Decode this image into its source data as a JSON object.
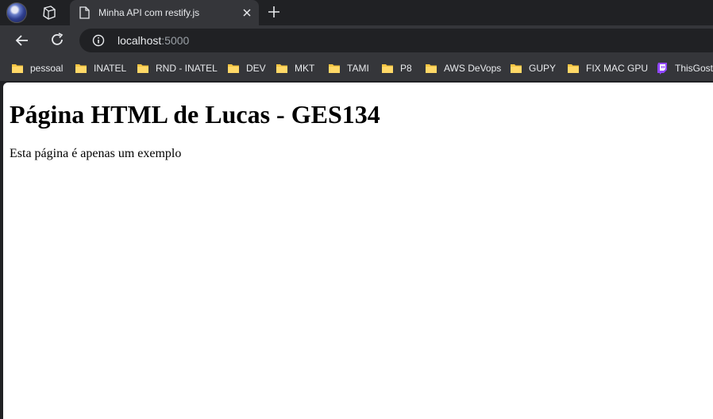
{
  "browser": {
    "tab_title": "Minha API com restify.js",
    "url_host": "localhost",
    "url_port": ":5000"
  },
  "bookmarks": [
    {
      "label": "pessoal",
      "icon": "folder-icon"
    },
    {
      "label": "INATEL",
      "icon": "folder-icon"
    },
    {
      "label": "RND - INATEL",
      "icon": "folder-icon"
    },
    {
      "label": "DEV",
      "icon": "folder-icon"
    },
    {
      "label": "MKT",
      "icon": "folder-icon"
    },
    {
      "label": "TAMI",
      "icon": "folder-icon"
    },
    {
      "label": "P8",
      "icon": "folder-icon"
    },
    {
      "label": "AWS DeVops",
      "icon": "folder-icon"
    },
    {
      "label": "GUPY",
      "icon": "folder-icon"
    },
    {
      "label": "FIX MAC GPU",
      "icon": "folder-icon"
    },
    {
      "label": "ThisGosto",
      "icon": "twitch-icon"
    }
  ],
  "page": {
    "heading": "Página HTML de Lucas - GES134",
    "paragraph": "Esta página é apenas um exemplo"
  },
  "colors": {
    "chrome_dark": "#202124",
    "chrome_toolbar": "#35363a",
    "folder": "#f5c542",
    "twitch": "#9146ff"
  }
}
